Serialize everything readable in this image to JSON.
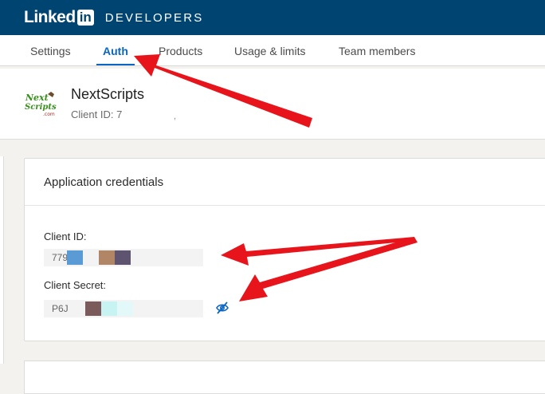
{
  "header": {
    "brand_linked": "Linked",
    "brand_in": "in",
    "brand_developers": "DEVELOPERS"
  },
  "tabs": [
    {
      "label": "Settings",
      "active": false
    },
    {
      "label": "Auth",
      "active": true
    },
    {
      "label": "Products",
      "active": false
    },
    {
      "label": "Usage & limits",
      "active": false
    },
    {
      "label": "Team members",
      "active": false
    }
  ],
  "app": {
    "name": "NextScripts",
    "client_id_text": "Client ID: 7",
    "dot": ","
  },
  "credentials": {
    "title": "Application credentials",
    "client_id_label": "Client ID:",
    "client_id_value": "779",
    "client_secret_label": "Client Secret:",
    "client_secret_value": "P6J"
  },
  "icons": {
    "visibility_toggle": "eye-slash-icon",
    "logo": "nextscripts-logo"
  },
  "colors": {
    "topbar": "#004471",
    "accent": "#0a66c2",
    "annotation_arrow": "#e8141b"
  }
}
